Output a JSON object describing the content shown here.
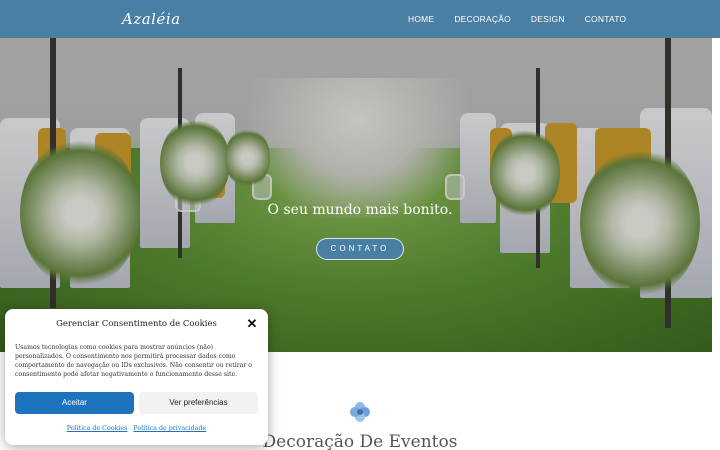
{
  "header": {
    "logo": "Azaléia",
    "nav": [
      "HOME",
      "DECORAÇÃO",
      "DESIGN",
      "CONTATO"
    ]
  },
  "hero": {
    "tagline": "O seu mundo mais bonito.",
    "cta": "CONTATO"
  },
  "section": {
    "title": "Decoração De Eventos",
    "icon": "flower-icon"
  },
  "cookie": {
    "title": "Gerenciar Consentimento de Cookies",
    "close_icon": "close-icon",
    "text": "Usamos tecnologias como cookies para mostrar anúncios (não) personalizados. O consentimento nos permitirá processar dados como comportamento de navegação ou IDs exclusivos. Não consentir ou retirar o consentimento pode afetar negativamente o funcionamento desse site.",
    "accept": "Aceitar",
    "preferences": "Ver preferências",
    "links": [
      "Política de Cookies",
      "Política de privacidade"
    ]
  },
  "colors": {
    "header": "#4a7fa4",
    "accept_button": "#1e73be"
  }
}
